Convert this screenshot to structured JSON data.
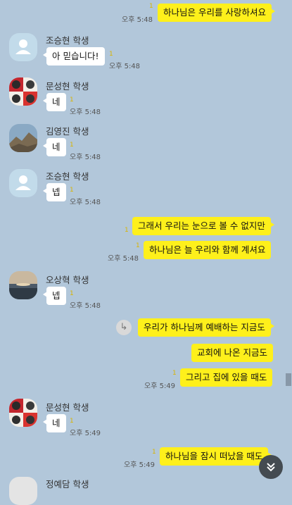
{
  "messages": [
    {
      "text": "하나님은 우리를 사랑하셔요",
      "time": "오후 5:48",
      "unread": "1"
    },
    {
      "sender": "조승현 학생",
      "text": "아 믿습니다!",
      "time": "오후 5:48",
      "unread": "1"
    },
    {
      "sender": "문성현 학생",
      "text": "네",
      "time": "오후 5:48",
      "unread": "1"
    },
    {
      "sender": "김영진 학생",
      "text": "네",
      "time": "오후 5:48",
      "unread": "1"
    },
    {
      "sender": "조승현 학생",
      "text": "넵",
      "time": "오후 5:48",
      "unread": "1"
    },
    {
      "text": "그래서 우리는 눈으로 볼 수 없지만",
      "unread": "1"
    },
    {
      "text": "하나님은 늘 우리와 함께 계셔요",
      "time": "오후 5:48",
      "unread": "1"
    },
    {
      "sender": "오상혁 학생",
      "text": "넵",
      "time": "오후 5:48",
      "unread": "1"
    },
    {
      "text": "우리가 하나님께 예배하는 지금도"
    },
    {
      "text": "교회에 나온 지금도"
    },
    {
      "text": "그리고 집에 있을 때도",
      "time": "오후 5:49",
      "unread": "1"
    },
    {
      "sender": "문성현 학생",
      "text": "네",
      "time": "오후 5:49",
      "unread": "1"
    },
    {
      "text": "하나님을 잠시 떠났을 때도",
      "time": "오후 5:49",
      "unread": "1"
    },
    {
      "sender": "정예담 학생"
    }
  ],
  "icons": {
    "reply": "reply-arrow-icon",
    "scroll_down": "chevron-double-down-icon"
  },
  "colors": {
    "background": "#b2c7da",
    "outgoing_bubble": "#fef01b",
    "incoming_bubble": "#ffffff",
    "unread": "#d8b400"
  }
}
